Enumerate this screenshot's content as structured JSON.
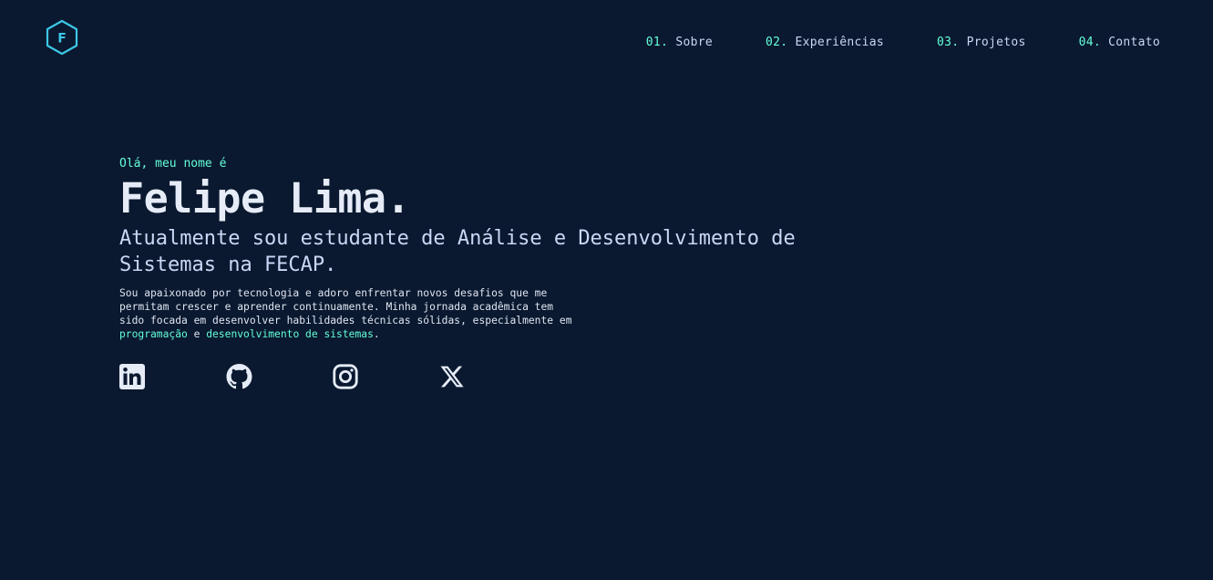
{
  "brand": {
    "logo_letter": "F",
    "accent_color": "#64ffda",
    "logo_color": "#3dc7e6",
    "background_color": "#0a192f"
  },
  "nav": {
    "items": [
      {
        "number": "01.",
        "label": "Sobre"
      },
      {
        "number": "02.",
        "label": "Experiências"
      },
      {
        "number": "03.",
        "label": "Projetos"
      },
      {
        "number": "04.",
        "label": "Contato"
      }
    ]
  },
  "hero": {
    "greeting": "Olá, meu nome é",
    "name": "Felipe Lima.",
    "tagline": "Atualmente sou estudante de Análise e Desenvolvimento de Sistemas na FECAP.",
    "bio": {
      "text_before": "Sou apaixonado por tecnologia e adoro enfrentar novos desafios que me permitam crescer e aprender continuamente. Minha jornada acadêmica tem sido focada em desenvolver habilidades técnicas sólidas, especialmente em ",
      "highlight_1": "programação",
      "text_middle": " e ",
      "highlight_2": "desenvolvimento de sistemas",
      "text_after": "."
    }
  },
  "socials": [
    {
      "icon": "linkedin-icon"
    },
    {
      "icon": "github-icon"
    },
    {
      "icon": "instagram-icon"
    },
    {
      "icon": "x-twitter-icon"
    }
  ]
}
